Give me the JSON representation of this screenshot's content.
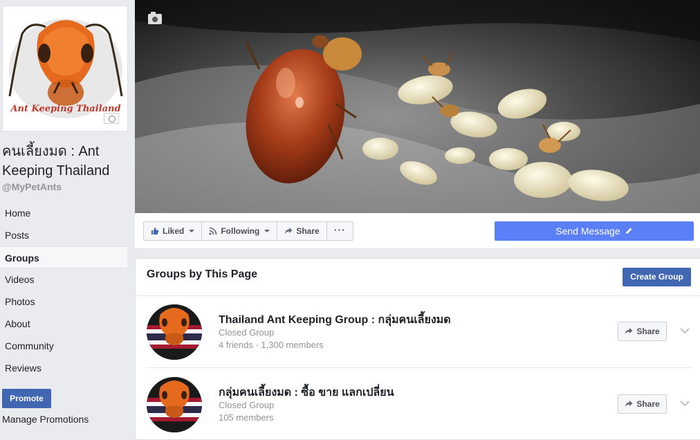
{
  "page": {
    "name": "คนเลี้ยงมด : Ant Keeping Thailand",
    "handle": "@MyPetAnts",
    "logo_text": "Ant Keeping Thailand"
  },
  "sidebar": {
    "items": [
      {
        "label": "Home",
        "active": false
      },
      {
        "label": "Posts",
        "active": false
      },
      {
        "label": "Groups",
        "active": true
      },
      {
        "label": "Videos",
        "active": false
      },
      {
        "label": "Photos",
        "active": false
      },
      {
        "label": "About",
        "active": false
      },
      {
        "label": "Community",
        "active": false
      },
      {
        "label": "Reviews",
        "active": false
      }
    ],
    "promote_label": "Promote",
    "manage_promotions_label": "Manage Promotions"
  },
  "action_bar": {
    "liked_label": "Liked",
    "following_label": "Following",
    "share_label": "Share",
    "more_label": "···",
    "send_message_label": "Send Message"
  },
  "groups": {
    "title": "Groups by This Page",
    "create_label": "Create Group",
    "share_label": "Share",
    "list": [
      {
        "name": "Thailand Ant Keeping Group : กลุ่มคนเลี้ยงมด",
        "type": "Closed Group",
        "members": "4 friends · 1,300 members"
      },
      {
        "name": "กลุ่มคนเลี้ยงมด : ซื้อ ขาย แลกเปลี่ยน",
        "type": "Closed Group",
        "members": "105 members"
      }
    ]
  },
  "colors": {
    "primary": "#4267b2",
    "send_message": "#5b7ff6",
    "background": "#e9ebee",
    "muted_text": "#90949c"
  }
}
